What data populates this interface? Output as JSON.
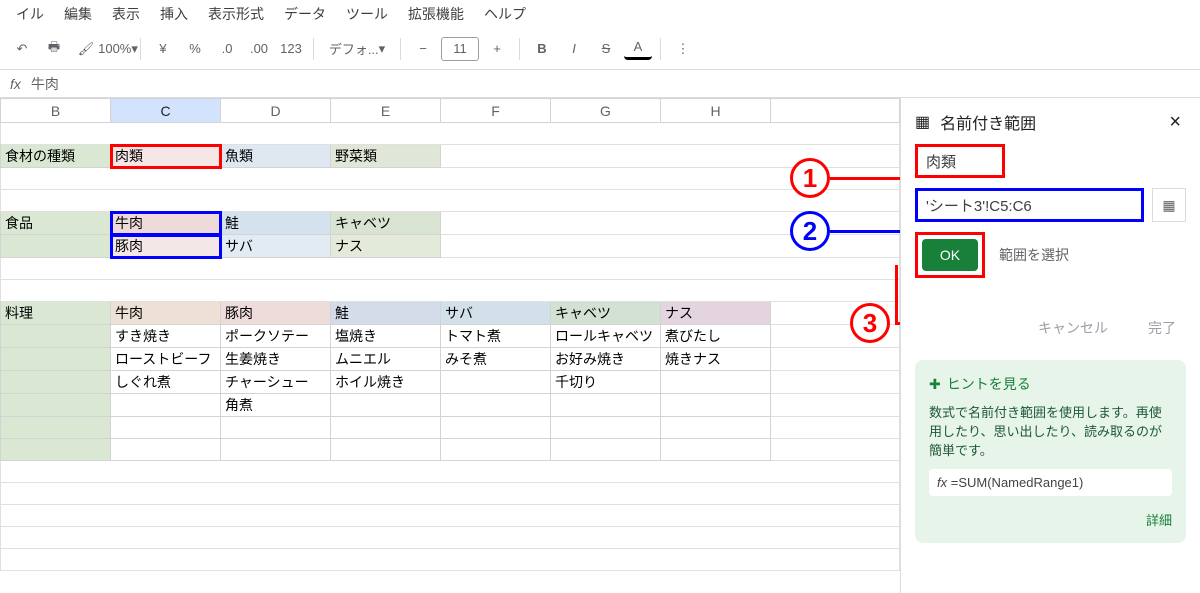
{
  "menu": [
    "イル",
    "編集",
    "表示",
    "挿入",
    "表示形式",
    "データ",
    "ツール",
    "拡張機能",
    "ヘルプ"
  ],
  "toolbar": {
    "zoom": "100%",
    "currency": "¥",
    "percent": "%",
    "dec_minus": ".0",
    "dec_plus": ".00",
    "num123": "123",
    "font": "デフォ...",
    "fontsize": "11",
    "bold": "B",
    "italic": "I",
    "strike": "S",
    "textcolor": "A"
  },
  "formula": {
    "fx_label": "fx",
    "value": "牛肉"
  },
  "columns": [
    "B",
    "C",
    "D",
    "E",
    "F",
    "G",
    "H"
  ],
  "sheet": {
    "row2": {
      "b": "食材の種類",
      "c": "肉類",
      "d": "魚類",
      "e": "野菜類"
    },
    "row5": {
      "b": "食品",
      "c": "牛肉",
      "d": "鮭",
      "e": "キャベツ"
    },
    "row6": {
      "c": "豚肉",
      "d": "サバ",
      "e": "ナス"
    },
    "row9": {
      "b": "料理",
      "c": "牛肉",
      "d": "豚肉",
      "e": "鮭",
      "f": "サバ",
      "g": "キャベツ",
      "h": "ナス"
    },
    "row10": {
      "c": "すき焼き",
      "d": "ポークソテー",
      "e": "塩焼き",
      "f": "トマト煮",
      "g": "ロールキャベツ",
      "h": "煮びたし"
    },
    "row11": {
      "c": "ローストビーフ",
      "d": "生姜焼き",
      "e": "ムニエル",
      "f": "みそ煮",
      "g": "お好み焼き",
      "h": "焼きナス"
    },
    "row12": {
      "c": "しぐれ煮",
      "d": "チャーシュー",
      "e": "ホイル焼き",
      "g": "千切り"
    },
    "row13": {
      "d": "角煮"
    }
  },
  "panel": {
    "title": "名前付き範囲",
    "name_input": "肉類",
    "range_input": "'シート3'!C5:C6",
    "ok": "OK",
    "range_select": "範囲を選択",
    "cancel": "キャンセル",
    "done": "完了",
    "hint_title": "ヒントを見る",
    "hint_body": "数式で名前付き範囲を使用します。再使用したり、思い出したり、読み取るのが簡単です。",
    "formula_example": "=SUM(NamedRange1)",
    "fx_icon": "fx",
    "detail": "詳細"
  },
  "annotations": {
    "n1": "1",
    "n2": "2",
    "n3": "3"
  }
}
